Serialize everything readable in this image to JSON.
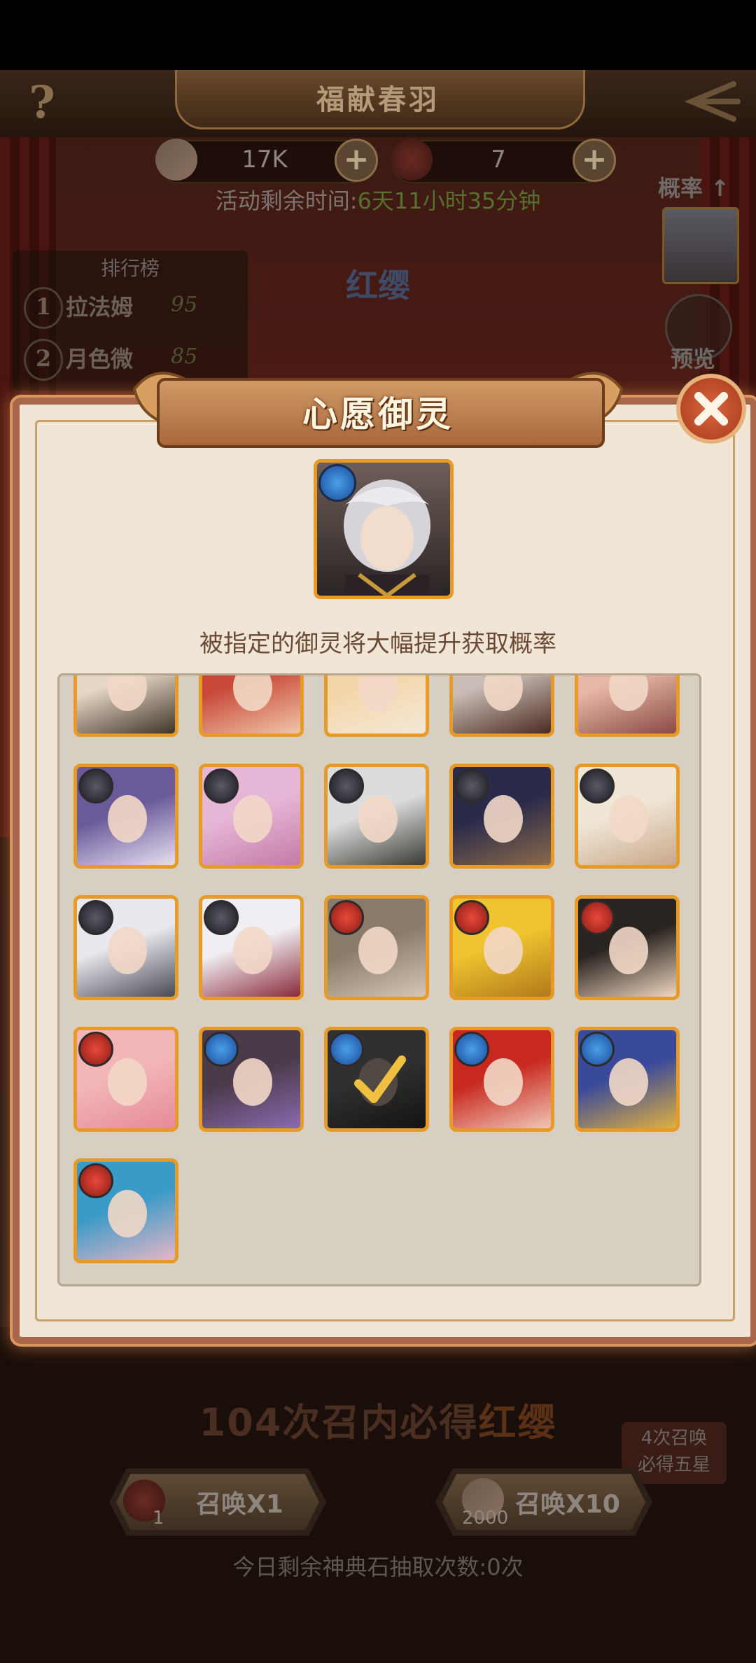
{
  "header": {
    "title": "福献春羽",
    "help": "?"
  },
  "currency": [
    {
      "icon": "gem-icon",
      "value": "17K"
    },
    {
      "icon": "blessing-token-icon",
      "value": "7"
    }
  ],
  "event": {
    "remaining_label": "活动剩余时间:",
    "remaining_value": "6天11小时35分钟",
    "featured_hero": "红缨"
  },
  "ranking": {
    "title": "排行榜",
    "rows": [
      {
        "rank": "1",
        "name": "拉法姆",
        "score": "95"
      },
      {
        "rank": "2",
        "name": "月色微",
        "score": "85"
      }
    ]
  },
  "side": {
    "probability": "概率",
    "preview": "预览"
  },
  "modal": {
    "title": "心愿御灵",
    "subtitle": "被指定的御灵将大幅提升获取概率",
    "selected_element": "water",
    "cards": [
      {
        "element": "none",
        "palette": [
          "#e7d7c6",
          "#3e3426"
        ],
        "selected": false
      },
      {
        "element": "none",
        "palette": [
          "#c8483a",
          "#f0c6a8"
        ],
        "selected": false
      },
      {
        "element": "none",
        "palette": [
          "#f3d6a8",
          "#f5e7d6"
        ],
        "selected": false
      },
      {
        "element": "none",
        "palette": [
          "#c9bcb6",
          "#4a2a20"
        ],
        "selected": false
      },
      {
        "element": "none",
        "palette": [
          "#e6b6a6",
          "#8a4a44"
        ],
        "selected": false
      },
      {
        "element": "dark",
        "palette": [
          "#6a5a9a",
          "#e8dff0"
        ],
        "selected": false
      },
      {
        "element": "dark",
        "palette": [
          "#e6b6d6",
          "#c47aa8"
        ],
        "selected": false
      },
      {
        "element": "dark",
        "palette": [
          "#dcdcdc",
          "#3a3a34"
        ],
        "selected": false
      },
      {
        "element": "dark",
        "palette": [
          "#2a2a4a",
          "#8a6a4a"
        ],
        "selected": false
      },
      {
        "element": "dark",
        "palette": [
          "#f0e6d6",
          "#c8a88a"
        ],
        "selected": false
      },
      {
        "element": "dark",
        "palette": [
          "#e8e8ee",
          "#4a4a56"
        ],
        "selected": false
      },
      {
        "element": "dark",
        "palette": [
          "#f0eef2",
          "#8a2a3a"
        ],
        "selected": false
      },
      {
        "element": "fire",
        "palette": [
          "#8a7a6a",
          "#d6c6b6"
        ],
        "selected": false
      },
      {
        "element": "fire",
        "palette": [
          "#f0c430",
          "#b07a1a"
        ],
        "selected": false
      },
      {
        "element": "fire",
        "palette": [
          "#2a2420",
          "#f0d6c0"
        ],
        "selected": false
      },
      {
        "element": "fire",
        "palette": [
          "#f2b6b6",
          "#e68a9a"
        ],
        "selected": false
      },
      {
        "element": "water",
        "palette": [
          "#4a3a4a",
          "#8a6ab0"
        ],
        "selected": false
      },
      {
        "element": "water",
        "palette": [
          "#8a8a8a",
          "#3a3630"
        ],
        "selected": true
      },
      {
        "element": "water",
        "palette": [
          "#c8281e",
          "#f0c6b6"
        ],
        "selected": false
      },
      {
        "element": "water",
        "palette": [
          "#3a4a9a",
          "#e0b040"
        ],
        "selected": false
      },
      {
        "element": "fire",
        "palette": [
          "#3a9ac8",
          "#e6b6c6"
        ],
        "selected": false
      }
    ]
  },
  "summon": {
    "guarantee_prefix": "104次召内必得",
    "guarantee_hero": "红缨",
    "five_star_line1": "4次召唤",
    "five_star_line2": "必得五星",
    "single": {
      "label": "召唤X1",
      "cost": "1"
    },
    "ten": {
      "label": "召唤X10",
      "cost": "2000"
    },
    "daily": "今日剩余神典石抽取次数:0次"
  }
}
